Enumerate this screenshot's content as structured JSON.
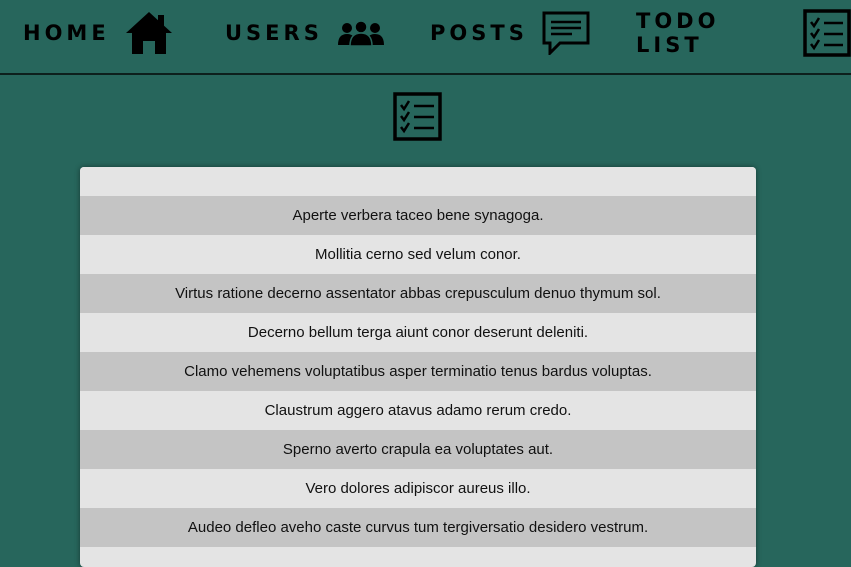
{
  "nav": {
    "home": {
      "label": "HOME",
      "icon": "home-icon"
    },
    "users": {
      "label": "USERS",
      "icon": "users-icon"
    },
    "posts": {
      "label": "POSTS",
      "icon": "chat-bubble-icon"
    },
    "todo": {
      "label": "TODO LIST",
      "icon": "checklist-icon"
    }
  },
  "page": {
    "icon": "checklist-icon"
  },
  "todos": [
    "Aperte verbera taceo bene synagoga.",
    "Mollitia cerno sed velum conor.",
    "Virtus ratione decerno assentator abbas crepusculum denuo thymum sol.",
    "Decerno bellum terga aiunt conor deserunt deleniti.",
    "Clamo vehemens voluptatibus asper terminatio tenus bardus voluptas.",
    "Claustrum aggero atavus adamo rerum credo.",
    "Sperno averto crapula ea voluptates aut.",
    "Vero dolores adipiscor aureus illo.",
    "Audeo defleo aveho caste curvus tum tergiversatio desidero vestrum."
  ],
  "colors": {
    "background": "#27665c",
    "row_dark": "#c4c4c4",
    "row_light": "#e4e4e4"
  }
}
